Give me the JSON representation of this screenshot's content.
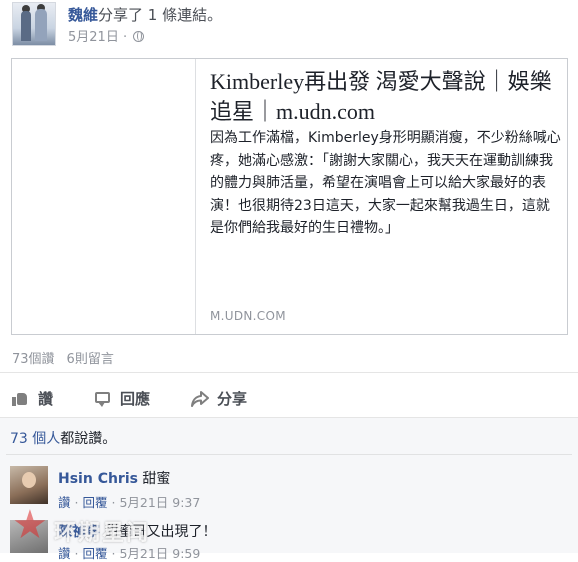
{
  "post": {
    "author": "魏維",
    "action_text": "分享了 1 條連結。",
    "date": "5月21日",
    "separator": "·"
  },
  "link_card": {
    "title": "Kimberley再出發 渴愛大聲說｜娛樂追星｜m.udn.com",
    "description": "因為工作滿檔，Kimberley身形明顯消瘦，不少粉絲喊心疼，她滿心感激：「謝謝大家關心，我天天在運動訓練我的體力與肺活量，希望在演唱會上可以給大家最好的表演！也很期待23日這天，大家一起來幫我過生日，這就是你們給我最好的生日禮物。」",
    "domain": "M.UDN.COM"
  },
  "stats": {
    "likes": "73個讚",
    "comments": "6則留言"
  },
  "actions": {
    "like": "讚",
    "comment": "回應",
    "share": "分享"
  },
  "likes_summary": {
    "count": "73 個人",
    "suffix": "都說讚。"
  },
  "comments": [
    {
      "name": "Hsin Chris",
      "text": "甜蜜",
      "like": "讚",
      "reply": "回覆",
      "dot": "·",
      "time": "5月21日 9:37"
    },
    {
      "name": "陳禎寧",
      "text": "甜蜜哥又出現了！",
      "like": "讚",
      "reply": "回覆",
      "dot": "·",
      "time": "5月21日 9:59"
    }
  ],
  "watermark": {
    "text": "环期星闻"
  },
  "colors": {
    "link_blue": "#365899",
    "meta_gray": "#90949c",
    "panel_bg": "#f6f7f9"
  },
  "icons": [
    "globe-icon",
    "like-icon",
    "comment-icon",
    "share-icon"
  ]
}
